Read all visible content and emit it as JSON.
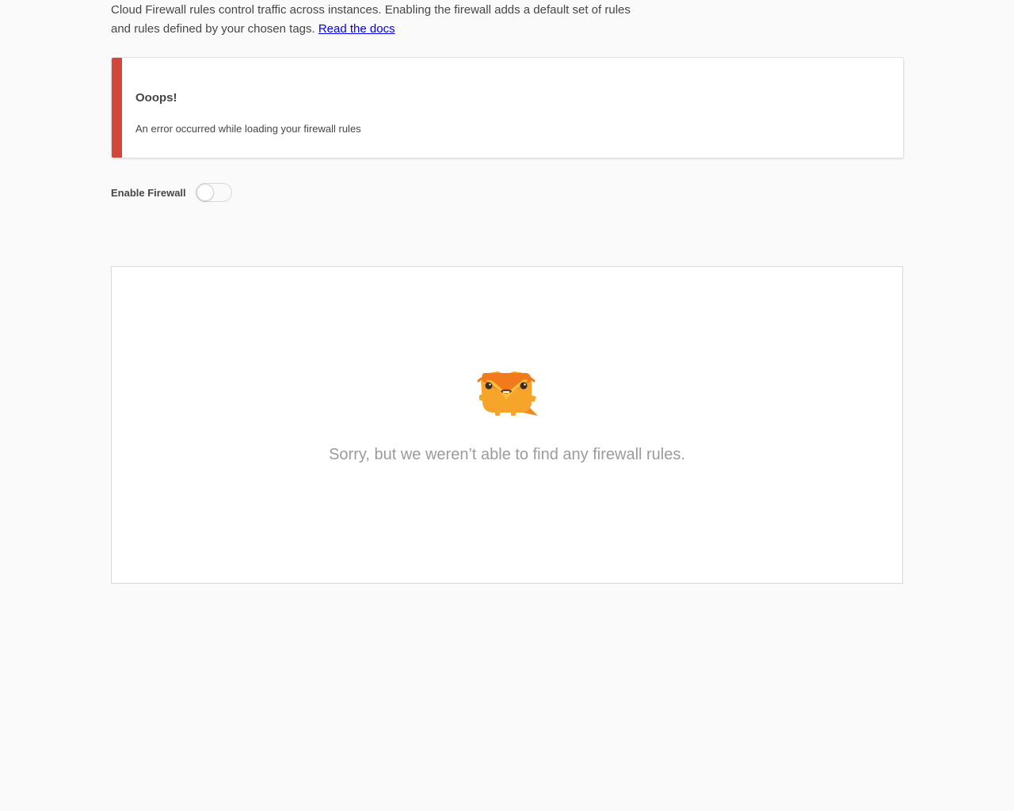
{
  "intro": {
    "text": "Cloud Firewall rules control traffic across instances. Enabling the firewall adds a default set of rules and rules defined by your chosen tags.",
    "link_label": "Read the docs"
  },
  "error": {
    "title": "Ooops!",
    "message": "An error occurred while loading your firewall rules",
    "accent_color": "#d3473b"
  },
  "firewall_toggle": {
    "label": "Enable Firewall",
    "enabled": false
  },
  "empty_state": {
    "icon": "mascot-illustration",
    "message": "Sorry, but we weren’t able to find any firewall rules."
  }
}
